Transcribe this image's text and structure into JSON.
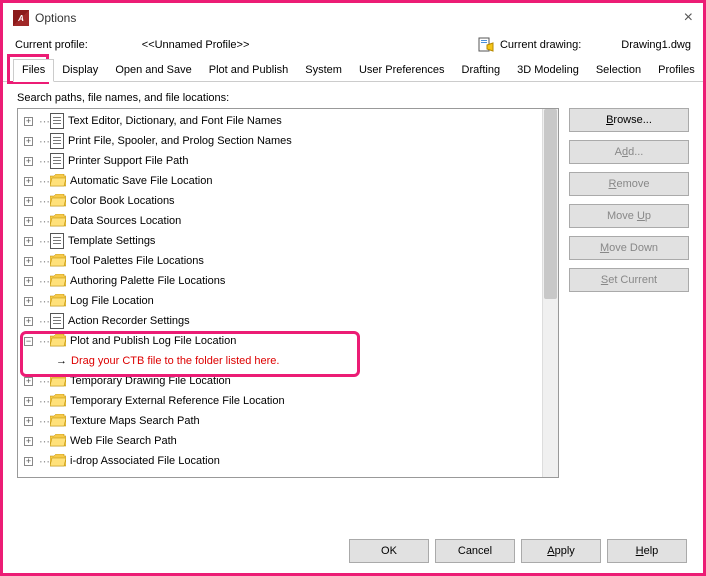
{
  "window": {
    "title": "Options"
  },
  "header": {
    "current_profile_label": "Current profile:",
    "profile_name": "<<Unnamed Profile>>",
    "current_drawing_label": "Current drawing:",
    "drawing_name": "Drawing1.dwg"
  },
  "tabs": [
    {
      "label": "Files",
      "active": true
    },
    {
      "label": "Display"
    },
    {
      "label": "Open and Save"
    },
    {
      "label": "Plot and Publish"
    },
    {
      "label": "System"
    },
    {
      "label": "User Preferences"
    },
    {
      "label": "Drafting"
    },
    {
      "label": "3D Modeling"
    },
    {
      "label": "Selection"
    },
    {
      "label": "Profiles"
    }
  ],
  "section_label": "Search paths, file names, and file locations:",
  "tree": [
    {
      "icon": "doc",
      "label": "Text Editor, Dictionary, and Font File Names"
    },
    {
      "icon": "doc",
      "label": "Print File, Spooler, and Prolog Section Names"
    },
    {
      "icon": "doc",
      "label": "Printer Support File Path"
    },
    {
      "icon": "folder",
      "label": "Automatic Save File Location"
    },
    {
      "icon": "folder",
      "label": "Color Book Locations"
    },
    {
      "icon": "folder",
      "label": "Data Sources Location"
    },
    {
      "icon": "doc",
      "label": "Template Settings"
    },
    {
      "icon": "folder",
      "label": "Tool Palettes File Locations"
    },
    {
      "icon": "folder",
      "label": "Authoring Palette File Locations"
    },
    {
      "icon": "folder",
      "label": "Log File Location"
    },
    {
      "icon": "doc",
      "label": "Action Recorder Settings"
    },
    {
      "icon": "folder",
      "label": "Plot and Publish Log File Location",
      "expanded": true,
      "child": "Drag your CTB file to the folder listed here."
    },
    {
      "icon": "folder",
      "label": "Temporary Drawing File Location"
    },
    {
      "icon": "folder",
      "label": "Temporary External Reference File Location"
    },
    {
      "icon": "folder",
      "label": "Texture Maps Search Path"
    },
    {
      "icon": "folder",
      "label": "Web File Search Path"
    },
    {
      "icon": "folder",
      "label": "i-drop Associated File Location"
    }
  ],
  "side_buttons": {
    "browse": "Browse...",
    "add": "Add...",
    "remove": "Remove",
    "move_up": "Move Up",
    "move_down": "Move Down",
    "set_current": "Set Current"
  },
  "bottom_buttons": {
    "ok": "OK",
    "cancel": "Cancel",
    "apply": "Apply",
    "help": "Help"
  }
}
